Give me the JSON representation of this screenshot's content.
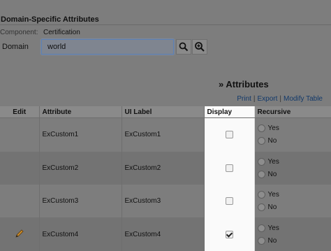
{
  "panel": {
    "title": "Domain-Specific Attributes"
  },
  "component": {
    "label": "Component:",
    "value": "Certification"
  },
  "domain": {
    "label": "Domain",
    "value": "world"
  },
  "icons": {
    "search": "search-icon",
    "zoom": "zoom-in-icon",
    "edit": "pencil-icon"
  },
  "attributes": {
    "heading": "» Attributes",
    "links": {
      "print": "Print",
      "export": "Export",
      "modify": "Modify Table",
      "separator": "|"
    }
  },
  "table": {
    "headers": {
      "edit": "Edit",
      "attribute": "Attribute",
      "ui_label": "UI Label",
      "display": "Display",
      "recursive": "Recursive"
    },
    "radio_labels": {
      "yes": "Yes",
      "no": "No"
    },
    "rows": [
      {
        "attribute": "ExCustom1",
        "ui_label": "ExCustom1",
        "display": false,
        "editable": false
      },
      {
        "attribute": "ExCustom2",
        "ui_label": "ExCustom2",
        "display": false,
        "editable": false
      },
      {
        "attribute": "ExCustom3",
        "ui_label": "ExCustom3",
        "display": false,
        "editable": false
      },
      {
        "attribute": "ExCustom4",
        "ui_label": "ExCustom4",
        "display": true,
        "editable": true
      }
    ]
  },
  "colors": {
    "overlay": "#7d7d7d",
    "link": "#12396a",
    "display_column": "#fafafa",
    "input_border": "#5b7fb3"
  }
}
